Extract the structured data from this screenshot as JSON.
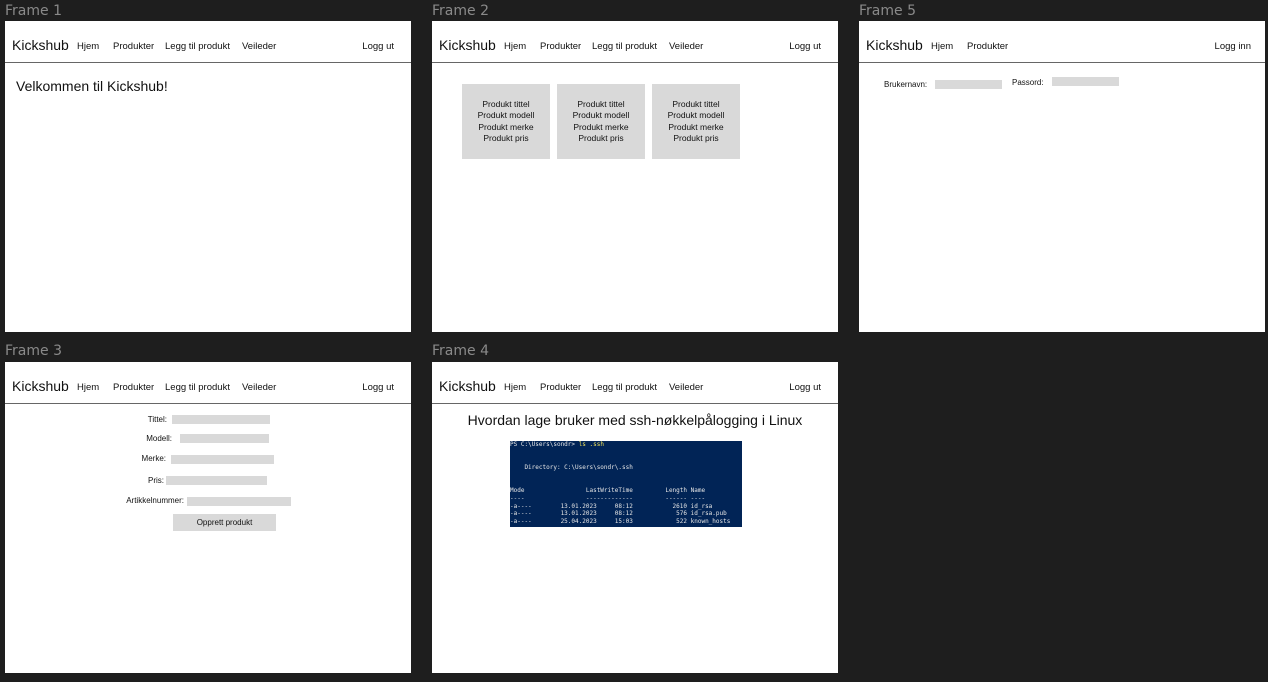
{
  "frames": {
    "f1": {
      "label": "Frame 1",
      "nav": {
        "brand": "Kickshub",
        "links": [
          "Hjem",
          "Produkter",
          "Legg til produkt",
          "Veileder"
        ],
        "right": "Logg ut"
      },
      "welcome": "Velkommen til Kickshub!"
    },
    "f2": {
      "label": "Frame 2",
      "nav": {
        "brand": "Kickshub",
        "links": [
          "Hjem",
          "Produkter",
          "Legg til produkt",
          "Veileder"
        ],
        "right": "Logg ut"
      },
      "cards": [
        {
          "title": "Produkt tittel",
          "model": "Produkt modell",
          "brand": "Produkt merke",
          "price": "Produkt pris"
        },
        {
          "title": "Produkt tittel",
          "model": "Produkt modell",
          "brand": "Produkt merke",
          "price": "Produkt pris"
        },
        {
          "title": "Produkt tittel",
          "model": "Produkt modell",
          "brand": "Produkt merke",
          "price": "Produkt pris"
        }
      ]
    },
    "f5": {
      "label": "Frame 5",
      "nav": {
        "brand": "Kickshub",
        "links": [
          "Hjem",
          "Produkter"
        ],
        "right": "Logg inn"
      },
      "login": {
        "username_label": "Brukernavn:",
        "password_label": "Passord:"
      }
    },
    "f3": {
      "label": "Frame 3",
      "nav": {
        "brand": "Kickshub",
        "links": [
          "Hjem",
          "Produkter",
          "Legg til produkt",
          "Veileder"
        ],
        "right": "Logg ut"
      },
      "form": {
        "title_label": "Tittel:",
        "model_label": "Modell:",
        "brand_label": "Merke:",
        "price_label": "Pris:",
        "article_label": "Artikkelnummer:",
        "submit": "Opprett produkt"
      }
    },
    "f4": {
      "label": "Frame 4",
      "nav": {
        "brand": "Kickshub",
        "links": [
          "Hjem",
          "Produkter",
          "Legg til produkt",
          "Veileder"
        ],
        "right": "Logg ut"
      },
      "guide_title": "Hvordan lage bruker med ssh-nøkkelpålogging i Linux",
      "terminal": {
        "prompt": "PS C:\\Users\\sondr> ",
        "command": "ls .ssh",
        "directory": "    Directory: C:\\Users\\sondr\\.ssh",
        "header": "Mode                 LastWriteTime         Length Name",
        "separator": "----                 -------------         ------ ----",
        "rows": [
          "-a----        13.01.2023     08:12           2610 id_rsa",
          "-a----        13.01.2023     08:12            576 id_rsa.pub",
          "-a----        25.04.2023     15:03            522 known_hosts"
        ]
      }
    }
  }
}
